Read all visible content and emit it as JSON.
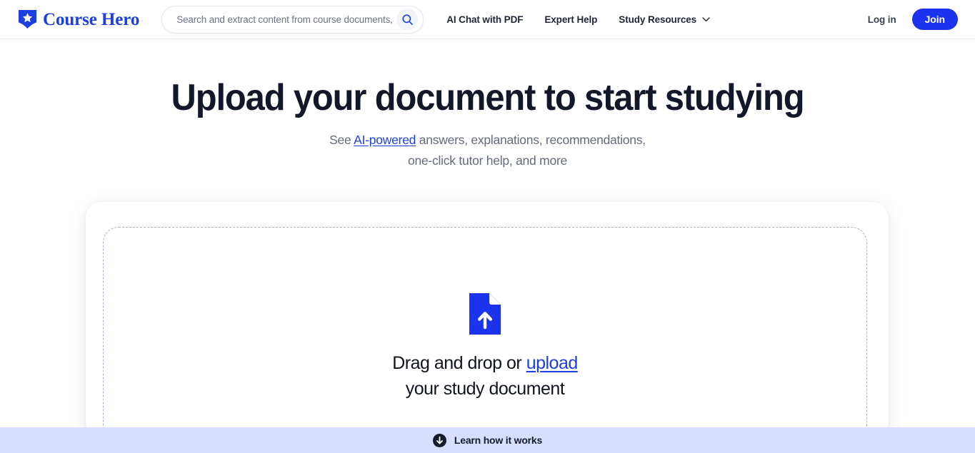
{
  "header": {
    "brand": {
      "name": "Course Hero",
      "icon": "shield-star-logo",
      "color": "#1d3fe0"
    },
    "search": {
      "placeholder": "Search and extract content from course documents,",
      "value": "",
      "icon": "search-icon"
    },
    "nav_items": [
      {
        "label": "AI Chat with PDF",
        "has_dropdown": false
      },
      {
        "label": "Expert Help",
        "has_dropdown": false
      },
      {
        "label": "Study Resources",
        "has_dropdown": true,
        "dropdown_icon": "chevron-down-icon"
      }
    ],
    "login_label": "Log in",
    "join_label": "Join",
    "join_color": "#1b33ec"
  },
  "hero": {
    "title": "Upload your document to start studying",
    "subtitle_before": "See ",
    "subtitle_link": "AI-powered",
    "subtitle_after": " answers, explanations, recommendations,",
    "subtitle_line2": "one-click tutor help, and more"
  },
  "upload": {
    "icon": "document-upload-icon",
    "icon_color": "#1b33ec",
    "text_before": "Drag and drop or ",
    "text_link": "upload",
    "text_line2": "your study document",
    "border_color": "#a9b1c2"
  },
  "bottom_bar": {
    "icon": "arrow-down-circle-icon",
    "label": "Learn how it works",
    "background": "#d9deff"
  }
}
